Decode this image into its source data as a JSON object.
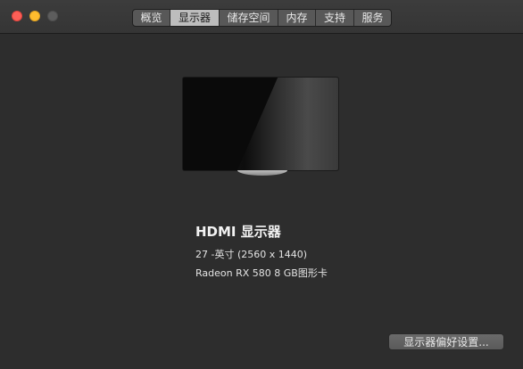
{
  "window": {
    "traffic_lights": [
      "close",
      "minimize",
      "zoom"
    ]
  },
  "tabs": [
    {
      "label": "概览",
      "active": false
    },
    {
      "label": "显示器",
      "active": true
    },
    {
      "label": "储存空间",
      "active": false
    },
    {
      "label": "内存",
      "active": false
    },
    {
      "label": "支持",
      "active": false
    },
    {
      "label": "服务",
      "active": false
    }
  ],
  "display": {
    "name": "HDMI 显示器",
    "size_resolution": "27 -英寸 (2560 x 1440)",
    "graphics": "Radeon RX 580 8 GB图形卡",
    "icon": "monitor-icon"
  },
  "actions": {
    "preferences_button": "显示器偏好设置..."
  },
  "colors": {
    "close": "#fe5f57",
    "minimize": "#febc2e",
    "zoom_inactive": "#5d5d5d",
    "background": "#2d2d2d"
  }
}
